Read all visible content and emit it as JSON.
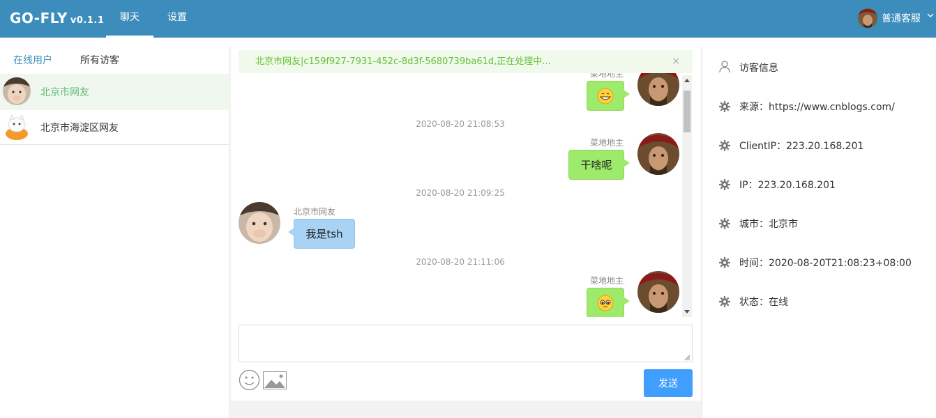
{
  "header": {
    "brand": "GO-FLY",
    "version": "v0.1.1",
    "nav": [
      "聊天",
      "设置"
    ],
    "user_name": "普通客服"
  },
  "left": {
    "tabs": [
      "在线用户",
      "所有访客"
    ],
    "visitors": [
      {
        "name": "北京市网友"
      },
      {
        "name": "北京市海淀区网友"
      }
    ]
  },
  "chat": {
    "notice": "北京市网友|c159f927-7931-452c-8d3f-5680739ba61d,正在处理中...",
    "notice_close": "×",
    "partial_author": "菜地地主",
    "messages": [
      {
        "time": "2020-08-20 21:08:53",
        "author": "菜地地主",
        "text": "干啥呢",
        "side": "right"
      },
      {
        "time": "2020-08-20 21:09:25",
        "author": "北京市网友",
        "text": "我是tsh",
        "side": "left"
      },
      {
        "time": "2020-08-20 21:11:06",
        "author": "菜地地主",
        "text": "",
        "side": "right"
      }
    ],
    "input_value": "",
    "send_label": "发送"
  },
  "info": {
    "title": "访客信息",
    "rows": [
      "来源：https://www.cnblogs.com/",
      "ClientIP：223.20.168.201",
      "IP：223.20.168.201",
      "城市：北京市",
      "时间：2020-08-20T21:08:23+08:00",
      "状态：在线"
    ]
  }
}
